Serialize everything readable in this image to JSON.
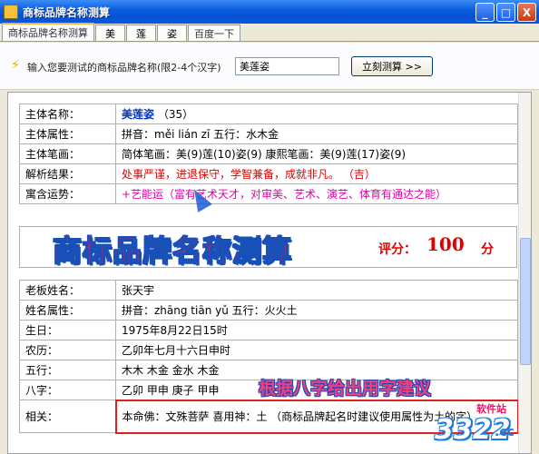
{
  "window": {
    "title": "商标品牌名称测算",
    "min": "_",
    "max": "□",
    "close": "X"
  },
  "tabs": [
    {
      "label": "商标品牌名称测算"
    },
    {
      "label": "美"
    },
    {
      "label": "莲"
    },
    {
      "label": "姿"
    },
    {
      "label": "百度一下"
    }
  ],
  "input": {
    "prompt": "输入您要测试的商标品牌名称(限2-4个汉字)",
    "value": "美莲姿",
    "button": "立刻测算 >>"
  },
  "brand": {
    "rows": [
      {
        "label": "主体名称：",
        "value": "美莲姿",
        "extra": "（35）"
      },
      {
        "label": "主体属性：",
        "value": "拼音：měi lián zī 五行：水木金"
      },
      {
        "label": "主体笔画：",
        "value": "简体笔画：美(9)莲(10)姿(9) 康熙笔画：美(9)莲(17)姿(9)"
      },
      {
        "label": "解析结果：",
        "value": "处事严谨，进退保守，学智兼备，成就非凡。   （吉）"
      },
      {
        "label": "寓含运势：",
        "value": "+艺能运（富有艺术天才，对审美、艺术、演艺、体育有通达之能）"
      }
    ]
  },
  "banner": {
    "title": "商标品牌名称测算",
    "score_label": "评分：",
    "score": "100",
    "score_unit": "分"
  },
  "owner": {
    "rows": [
      {
        "label": "老板姓名：",
        "value": "张天宇"
      },
      {
        "label": "姓名属性：",
        "value": "拼音：zhāng tiān yǔ 五行：火火土"
      },
      {
        "label": "生日：",
        "value": "1975年8月22日15时"
      },
      {
        "label": "农历：",
        "value": "乙卯年七月十六日申时"
      },
      {
        "label": "五行：",
        "value": "木木 木金 金水 木金"
      },
      {
        "label": "八字：",
        "value": "乙卯 甲申 庚子 甲申"
      },
      {
        "label": "相关：",
        "value": "本命佛：文殊菩萨     喜用神：土   （商标品牌起名时建议使用属性为土的字）"
      }
    ]
  },
  "annotation": "根据八字给出用字建议",
  "watermark": {
    "site": "软件站",
    "num": "3322",
    "cc": ".cc"
  },
  "colors": {
    "titlebar": "#0a5fe0",
    "accent_red": "#e00000",
    "accent_pink": "#e400a8",
    "name_blue": "#0033cc"
  }
}
